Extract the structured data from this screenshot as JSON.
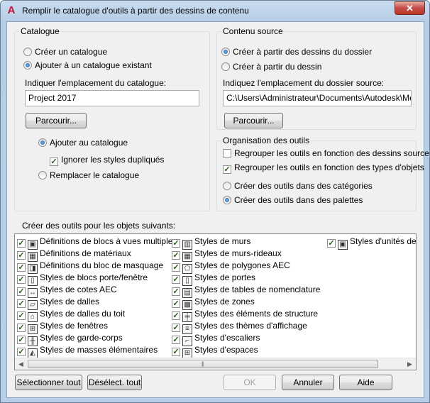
{
  "window": {
    "title": "Remplir le catalogue d'outils à partir des dessins de contenu",
    "close_label": "✕",
    "logo": "A"
  },
  "catalogue": {
    "legend": "Catalogue",
    "opt_create": "Créer un catalogue",
    "opt_existing": "Ajouter à un catalogue existant",
    "location_label": "Indiquer l'emplacement du catalogue:",
    "location_value": "Project 2017",
    "browse": "Parcourir...",
    "opt_add": "Ajouter au catalogue",
    "ignore_dupes": "Ignorer les styles dupliqués",
    "opt_replace": "Remplacer le catalogue",
    "selected": "existing",
    "mode": "add",
    "ignore_checked": true
  },
  "source": {
    "legend": "Contenu source",
    "opt_folder": "Créer à partir des dessins du dossier",
    "opt_drawing": "Créer à partir du dessin",
    "location_label": "Indiquez l'emplacement du dossier source:",
    "location_value": "C:\\Users\\Administrateur\\Documents\\Autodesk\\Mes pr",
    "browse": "Parcourir...",
    "selected": "folder"
  },
  "organisation": {
    "legend": "Organisation des outils",
    "by_drawing": "Regrouper les outils en fonction des dessins source",
    "by_type": "Regrouper les outils en fonction des types d'objets",
    "by_drawing_checked": false,
    "by_type_checked": true,
    "opt_categories": "Créer des outils dans des catégories",
    "opt_palettes": "Créer des outils dans des palettes",
    "selected": "palettes"
  },
  "objects": {
    "label": "Créer des outils pour les objets suivants:",
    "col1": [
      {
        "label": "Définitions de blocs à vues multiples",
        "icon": "multi-view-block-icon",
        "checked": true
      },
      {
        "label": "Définitions de matériaux",
        "icon": "material-icon",
        "checked": true
      },
      {
        "label": "Définitions du bloc de masquage",
        "icon": "mask-block-icon",
        "checked": true
      },
      {
        "label": "Styles de blocs porte/fenêtre",
        "icon": "door-window-icon",
        "checked": true
      },
      {
        "label": "Styles de cotes AEC",
        "icon": "dimension-icon",
        "checked": true
      },
      {
        "label": "Styles de dalles",
        "icon": "slab-icon",
        "checked": true
      },
      {
        "label": "Styles de dalles du toit",
        "icon": "roof-slab-icon",
        "checked": true
      },
      {
        "label": "Styles de fenêtres",
        "icon": "window-icon",
        "checked": true
      },
      {
        "label": "Styles de garde-corps",
        "icon": "railing-icon",
        "checked": true
      },
      {
        "label": "Styles de masses élémentaires",
        "icon": "mass-element-icon",
        "checked": true
      }
    ],
    "col2": [
      {
        "label": "Styles de murs",
        "icon": "wall-icon",
        "checked": true
      },
      {
        "label": "Styles de murs-rideaux",
        "icon": "curtain-wall-icon",
        "checked": true
      },
      {
        "label": "Styles de polygones AEC",
        "icon": "polygon-icon",
        "checked": true
      },
      {
        "label": "Styles de portes",
        "icon": "door-icon",
        "checked": true
      },
      {
        "label": "Styles de tables de nomenclature",
        "icon": "schedule-table-icon",
        "checked": true
      },
      {
        "label": "Styles de zones",
        "icon": "zone-icon",
        "checked": true
      },
      {
        "label": "Styles des éléments de structure",
        "icon": "structure-member-icon",
        "checked": true
      },
      {
        "label": "Styles des thèmes d'affichage",
        "icon": "display-theme-icon",
        "checked": true
      },
      {
        "label": "Styles d'escaliers",
        "icon": "stair-icon",
        "checked": true
      },
      {
        "label": "Styles d'espaces",
        "icon": "space-icon",
        "checked": true
      }
    ],
    "col3": [
      {
        "label": "Styles d'unités de r",
        "icon": "unit-icon",
        "checked": true
      }
    ]
  },
  "buttons": {
    "select_all": "Sélectionner tout",
    "deselect_all": "Désélect. tout",
    "ok": "OK",
    "cancel": "Annuler",
    "help": "Aide"
  }
}
